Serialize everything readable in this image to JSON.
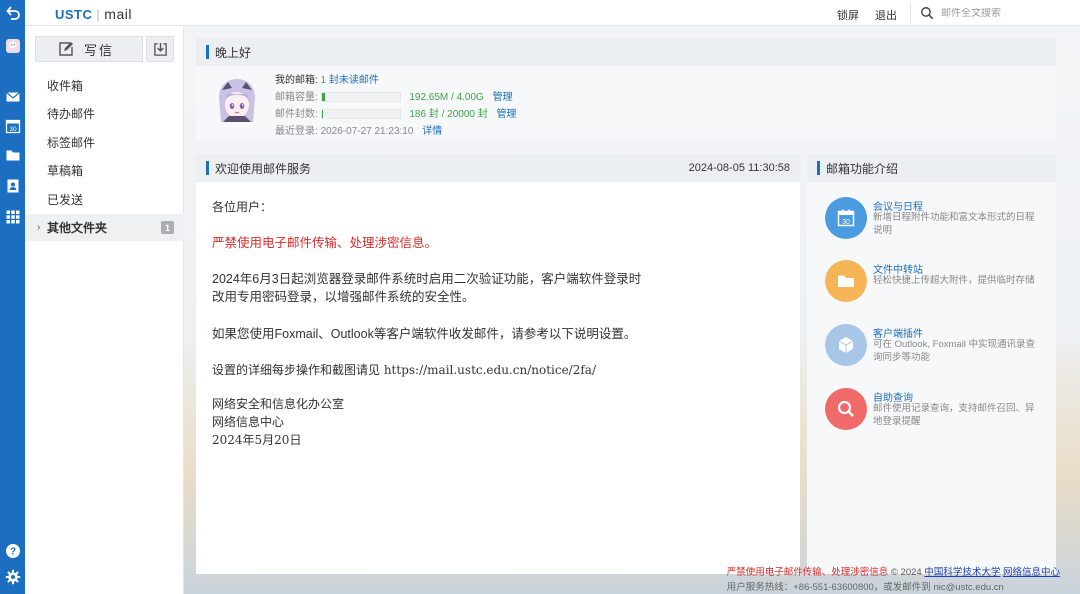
{
  "topbar": {
    "logo_brand": "USTC",
    "logo_sep": "|",
    "logo_product": "mail",
    "lock_label": "锁屏",
    "logout_label": "退出",
    "search_placeholder": "邮件全文搜索"
  },
  "sidebar": {
    "compose_label": "写信",
    "folders": [
      {
        "label": "收件箱"
      },
      {
        "label": "待办邮件"
      },
      {
        "label": "标签邮件"
      },
      {
        "label": "草稿箱"
      },
      {
        "label": "已发送"
      },
      {
        "label": "其他文件夹",
        "badge": "1"
      }
    ]
  },
  "greeting": {
    "title": "晚上好",
    "my_mailbox_label": "我的邮箱:",
    "unread_count": "1",
    "unread_label": "封未读邮件",
    "capacity_label": "邮箱容量:",
    "capacity_value": "192.65M / 4.00G",
    "capacity_fraction": 0.047,
    "capacity_manage": "管理",
    "count_label": "邮件封数:",
    "count_value": "186 封 / 20000 封",
    "count_fraction": 0.0093,
    "count_manage": "管理",
    "last_login_label": "最近登录:",
    "last_login_value": "2026-07-27 21:23:10",
    "details_link": "详情"
  },
  "notice": {
    "title": "欢迎使用邮件服务",
    "datetime": "2024-08-05 11:30:58",
    "salutation": "各位用户：",
    "warning": "严禁使用电子邮件传输、处理涉密信息。",
    "para1_line1": "2024年6月3日起浏览器登录邮件系统时启用二次验证功能，客户端软件登录时",
    "para1_line2": "改用专用密码登录，以增强邮件系统的安全性。",
    "para2": "如果您使用Foxmail、Outlook等客户端软件收发邮件，请参考以下说明设置。",
    "para3": "设置的详细每步操作和截图请见 https://mail.ustc.edu.cn/notice/2fa/",
    "sign1": "网络安全和信息化办公室",
    "sign2": "网络信息中心",
    "sign_date": "2024年5月20日"
  },
  "features": {
    "title": "邮箱功能介绍",
    "items": [
      {
        "title": "会议与日程",
        "desc": "新增日程附件功能和富文本形式的日程说明",
        "color": "#4a9be0",
        "icon": "calendar-icon"
      },
      {
        "title": "文件中转站",
        "desc": "轻松快捷上传超大附件，提供临时存储",
        "color": "#f5b456",
        "icon": "folder-icon"
      },
      {
        "title": "客户端插件",
        "desc": "可在 Outlook, Foxmail 中实现通讯录查询同步等功能",
        "color": "#a8c6e8",
        "icon": "cube-icon"
      },
      {
        "title": "自助查询",
        "desc": "邮件使用记录查询，支持邮件召回、异地登录提醒",
        "color": "#f06a6a",
        "icon": "search-icon"
      }
    ]
  },
  "footer": {
    "warning": "严禁使用电子邮件传输、处理涉密信息",
    "copyright": "© 2024",
    "link1": "中国科学技术大学",
    "link2": "网络信息中心",
    "line2": "用户服务热线：+86-551-63600800，或发邮件到 nic@ustc.edu.cn"
  },
  "colors": {
    "accent": "#1c6fc0",
    "warning_red": "#d92b2b",
    "progress_green": "#3aa648"
  }
}
